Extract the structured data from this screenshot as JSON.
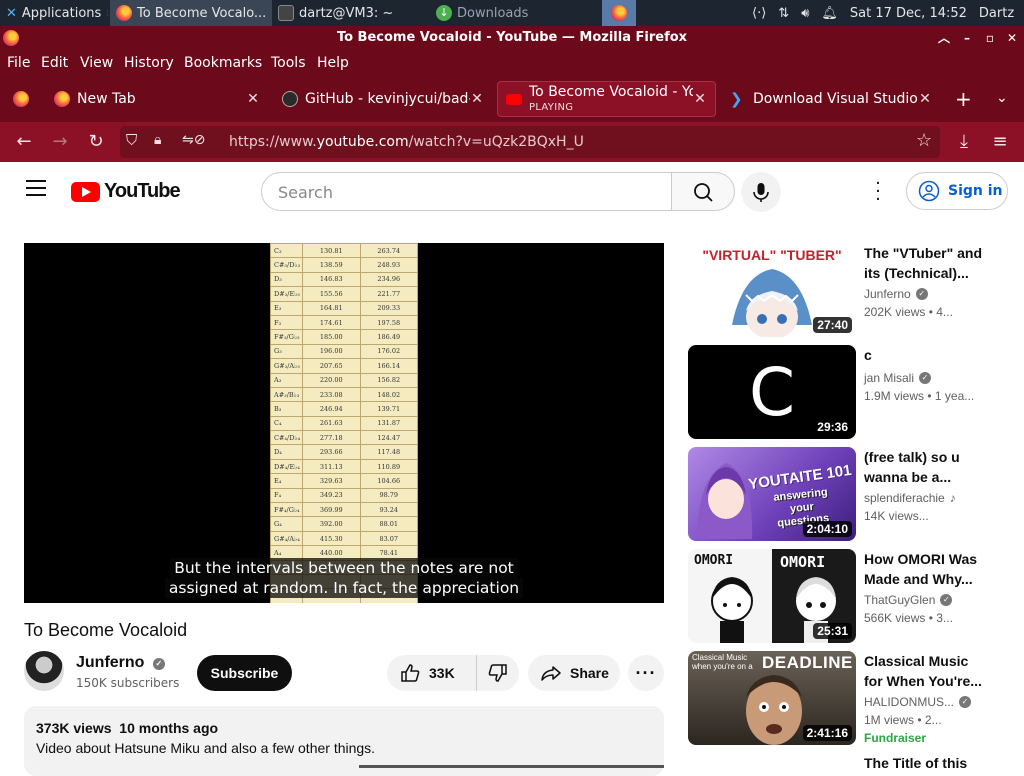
{
  "taskbar": {
    "apps_label": "Applications",
    "items": [
      {
        "label": "To Become Vocalo..."
      },
      {
        "label": "dartz@VM3: ~"
      },
      {
        "label": "Downloads"
      }
    ],
    "datetime": "Sat 17 Dec, 14:52",
    "user": "Dartz"
  },
  "window": {
    "title": "To Become Vocaloid - YouTube — Mozilla Firefox"
  },
  "menu": [
    "File",
    "Edit",
    "View",
    "History",
    "Bookmarks",
    "Tools",
    "Help"
  ],
  "tabs": [
    {
      "label": "New Tab"
    },
    {
      "label": "GitHub - kevinjycui/bad-a"
    },
    {
      "label": "To Become Vocaloid - YouTube",
      "status": "PLAYING"
    },
    {
      "label": "Download Visual Studio C"
    }
  ],
  "nav": {
    "url_prefix": "https://www.",
    "url_host": "youtube.com",
    "url_path": "/watch?v=uQzk2BQxH_U"
  },
  "youtube": {
    "logo_text": "YouTube",
    "search_placeholder": "Search",
    "signin_label": "Sign in"
  },
  "video": {
    "sheet_rows": [
      [
        "C₃",
        "130.81",
        "263.74"
      ],
      [
        "C#₃/D♭₃",
        "138.59",
        "248.93"
      ],
      [
        "D₃",
        "146.83",
        "234.96"
      ],
      [
        "D#₃/E♭₃",
        "155.56",
        "221.77"
      ],
      [
        "E₃",
        "164.81",
        "209.33"
      ],
      [
        "F₃",
        "174.61",
        "197.58"
      ],
      [
        "F#₃/G♭₃",
        "185.00",
        "186.49"
      ],
      [
        "G₃",
        "196.00",
        "176.02"
      ],
      [
        "G#₃/A♭₃",
        "207.65",
        "166.14"
      ],
      [
        "A₃",
        "220.00",
        "156.82"
      ],
      [
        "A#₃/B♭₃",
        "233.08",
        "148.02"
      ],
      [
        "B₃",
        "246.94",
        "139.71"
      ],
      [
        "C₄",
        "261.63",
        "131.87"
      ],
      [
        "C#₄/D♭₄",
        "277.18",
        "124.47"
      ],
      [
        "D₄",
        "293.66",
        "117.48"
      ],
      [
        "D#₄/E♭₄",
        "311.13",
        "110.89"
      ],
      [
        "E₄",
        "329.63",
        "104.66"
      ],
      [
        "F₄",
        "349.23",
        "98.79"
      ],
      [
        "F#₄/G♭₄",
        "369.99",
        "93.24"
      ],
      [
        "G₄",
        "392.00",
        "88.01"
      ],
      [
        "G#₄/A♭₄",
        "415.30",
        "83.07"
      ],
      [
        "A₄",
        "440.00",
        "78.41"
      ],
      [
        "",
        "",
        ""
      ],
      [
        "",
        "",
        ""
      ],
      [
        "",
        "",
        ""
      ]
    ],
    "subtitle_line1": "But the intervals between the notes are not",
    "subtitle_line2": "assigned at random. In fact, the appreciation",
    "title": "To Become Vocaloid",
    "channel": "Junferno",
    "subscribers": "150K subscribers",
    "subscribe_label": "Subscribe",
    "likes": "33K",
    "share_label": "Share",
    "views": "373K views",
    "age": "10 months ago",
    "description": "Video about Hatsune Miku and also a few other things."
  },
  "recommendations": [
    {
      "title_l1": "The \"VTuber\" and",
      "title_l2": "its (Technical)...",
      "channel": "Junferno",
      "verified": true,
      "meta": "202K views  • 4...",
      "duration": "27:40",
      "thumb_text": "\"VIRTUAL\" \"TUBER\""
    },
    {
      "title_l1": "c",
      "title_l2": "",
      "channel": "jan Misali",
      "verified": true,
      "meta": "1.9M views  • 1 yea...",
      "duration": "29:36",
      "thumb_text": "C"
    },
    {
      "title_l1": "(free talk) so u",
      "title_l2": "wanna be a...",
      "channel": "splendiferachie",
      "verified": false,
      "music": true,
      "meta": "14K views...",
      "duration": "2:04:10",
      "thumb_text": "YOUTAITE 101",
      "thumb_sub": "answering your questions"
    },
    {
      "title_l1": "How OMORI Was",
      "title_l2": "Made and Why...",
      "channel": "ThatGuyGlen",
      "verified": true,
      "meta": "566K views  • 3...",
      "duration": "25:31",
      "thumb_text": "OMORI",
      "thumb_text2": "OMORI"
    },
    {
      "title_l1": "Classical Music",
      "title_l2": "for When You're...",
      "channel": "HALIDONMUS...",
      "verified": true,
      "meta": "1M views  • 2...",
      "duration": "2:41:16",
      "thumb_text": "DEADLINE",
      "thumb_sub": "Classical Music when you're on a",
      "badge": "Fundraiser"
    },
    {
      "title_l1": "The Title of this",
      "title_l2": "",
      "channel": "",
      "meta": "",
      "duration": ""
    }
  ]
}
